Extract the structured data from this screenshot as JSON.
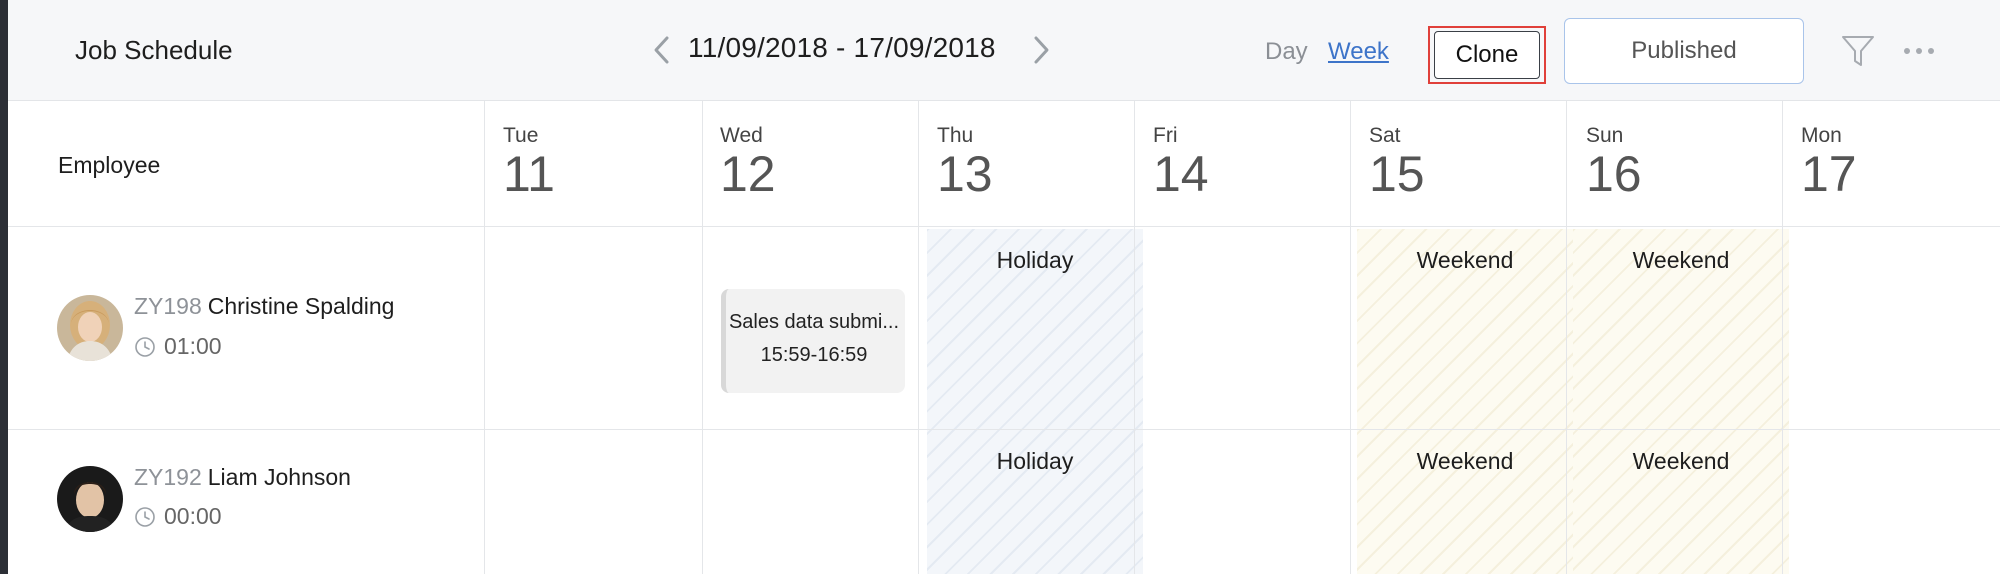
{
  "header": {
    "title": "Job Schedule",
    "date_range": "11/09/2018 - 17/09/2018",
    "view_day": "Day",
    "view_week": "Week",
    "clone_label": "Clone",
    "published_label": "Published",
    "icons": [
      "chevron-left-icon",
      "chevron-right-icon",
      "filter-icon",
      "more-icon"
    ]
  },
  "grid": {
    "employee_header": "Employee",
    "days": [
      {
        "name": "Tue",
        "num": "11"
      },
      {
        "name": "Wed",
        "num": "12"
      },
      {
        "name": "Thu",
        "num": "13"
      },
      {
        "name": "Fri",
        "num": "14"
      },
      {
        "name": "Sat",
        "num": "15"
      },
      {
        "name": "Sun",
        "num": "16"
      },
      {
        "name": "Mon",
        "num": "17"
      }
    ],
    "holiday_label": "Holiday",
    "weekend_label": "Weekend"
  },
  "employees": [
    {
      "id": "ZY198",
      "name": "Christine Spalding",
      "hours": "01:00",
      "shift": {
        "title": "Sales data submi...",
        "time": "15:59-16:59",
        "day": "Wed"
      }
    },
    {
      "id": "ZY192",
      "name": "Liam Johnson",
      "hours": "00:00"
    }
  ],
  "colors": {
    "accent_link": "#3d74c9",
    "highlight_border": "#e0403a",
    "holiday_bg": "#f3f6fa",
    "weekend_bg": "#fdfbf1"
  }
}
